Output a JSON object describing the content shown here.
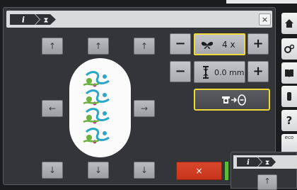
{
  "dialog": {
    "tabs": [
      {
        "icon": "info-icon",
        "label": "i"
      },
      {
        "icon": "hourglass-icon",
        "label": "⧗"
      }
    ],
    "close_label": "×"
  },
  "motif": {
    "icon": "embroidery-motif",
    "colors": {
      "primary": "#2aa6c9",
      "secondary": "#6db13f",
      "accent": "#c42e8a"
    }
  },
  "arrows": {
    "up": "↑",
    "down": "↓",
    "left": "←",
    "right": "→"
  },
  "scale": {
    "minus": "−",
    "plus": "+",
    "value": "4 x",
    "icon": "butterfly-icon"
  },
  "stitch_length": {
    "minus": "−",
    "plus": "+",
    "value": "0.0 mm",
    "icon": "stitch-length-icon"
  },
  "hoop_function": {
    "label": "⇥",
    "icon": "hoop-move-icon"
  },
  "cancel_label": "×",
  "sidebar": [
    {
      "name": "home-icon",
      "glyph": "⌂"
    },
    {
      "name": "settings-icon",
      "glyph": "⚙"
    },
    {
      "name": "book-icon",
      "glyph": "📖"
    },
    {
      "name": "tutorial-icon",
      "glyph": "▮"
    },
    {
      "name": "help-icon",
      "glyph": "?"
    },
    {
      "name": "eco-icon",
      "glyph": "eco"
    }
  ],
  "second_window": {
    "tabs": [
      {
        "label": "i"
      },
      {
        "label": "⧗"
      }
    ]
  },
  "colors": {
    "highlight": "#f0d83a",
    "cancel": "#d9472b",
    "panel": "#333539"
  }
}
